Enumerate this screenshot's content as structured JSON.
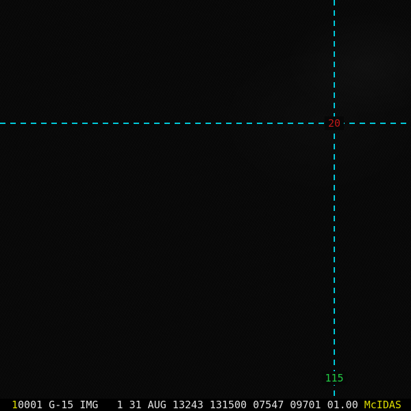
{
  "display": {
    "cursor_label": "20",
    "bottom_label": "115"
  },
  "status_bar": {
    "frame_number": "1",
    "info": "0001 G-15 IMG   1 31 AUG 13243 131500 07547 09701 01.00",
    "brand": "McIDAS"
  },
  "colors": {
    "crosshair": "#00ccdd",
    "cursor_label": "#c41818",
    "bottom_label": "#22cc44",
    "status_text": "#e2e2e2",
    "brand": "#dcdc00",
    "canvas_bg": "#070707"
  }
}
